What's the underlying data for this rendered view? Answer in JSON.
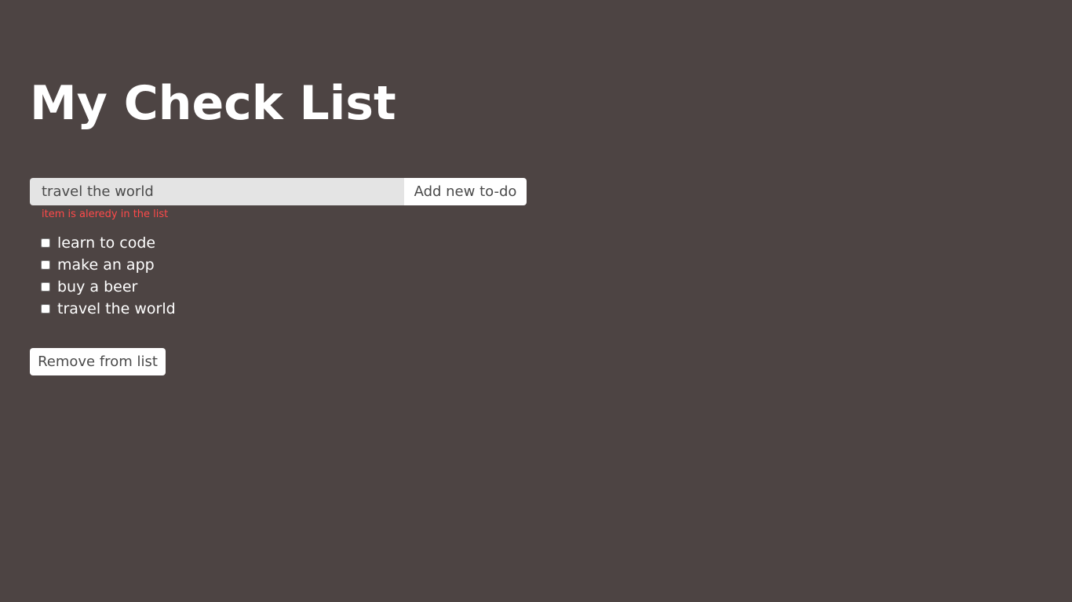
{
  "header": {
    "title": "My Check List"
  },
  "form": {
    "input_value": "travel the world",
    "add_label": "Add new to-do",
    "error_message": "item is aleredy in the list",
    "error_color": "#ff4a4a"
  },
  "todos": [
    {
      "label": "learn to code",
      "checked": false
    },
    {
      "label": "make an app",
      "checked": false
    },
    {
      "label": "buy a beer",
      "checked": false
    },
    {
      "label": "travel the world",
      "checked": false
    }
  ],
  "actions": {
    "remove_label": "Remove from list"
  },
  "colors": {
    "background": "#4d4443",
    "text": "#ffffff",
    "input_background": "#e4e4e4",
    "button_background": "#ffffff"
  }
}
